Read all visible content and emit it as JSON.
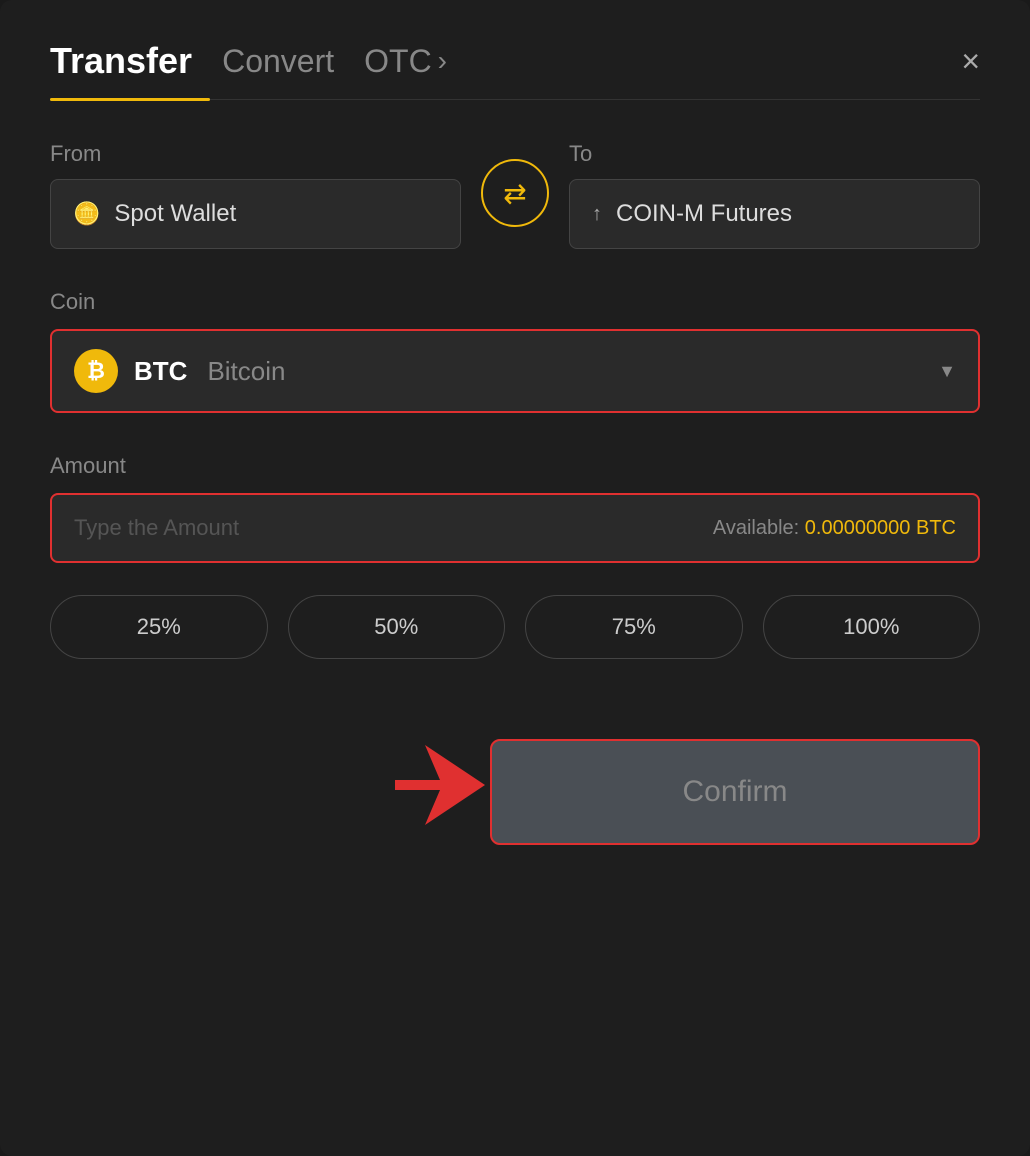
{
  "header": {
    "tab_transfer": "Transfer",
    "tab_convert": "Convert",
    "tab_otc": "OTC",
    "otc_chevron": "›",
    "close_label": "×"
  },
  "from": {
    "label": "From",
    "wallet_icon": "▬",
    "wallet_label": "Spot Wallet"
  },
  "to": {
    "label": "To",
    "futures_icon": "↑",
    "futures_label": "COIN-M Futures"
  },
  "swap": {
    "icon": "⇄"
  },
  "coin": {
    "label": "Coin",
    "btc_symbol": "₿",
    "btc_code": "BTC",
    "btc_name": "Bitcoin",
    "dropdown_arrow": "▼"
  },
  "amount": {
    "label": "Amount",
    "placeholder": "Type the Amount",
    "available_label": "Available:",
    "available_value": "0.00000000 BTC"
  },
  "percentages": [
    {
      "label": "25%"
    },
    {
      "label": "50%"
    },
    {
      "label": "75%"
    },
    {
      "label": "100%"
    }
  ],
  "confirm": {
    "label": "Confirm"
  }
}
